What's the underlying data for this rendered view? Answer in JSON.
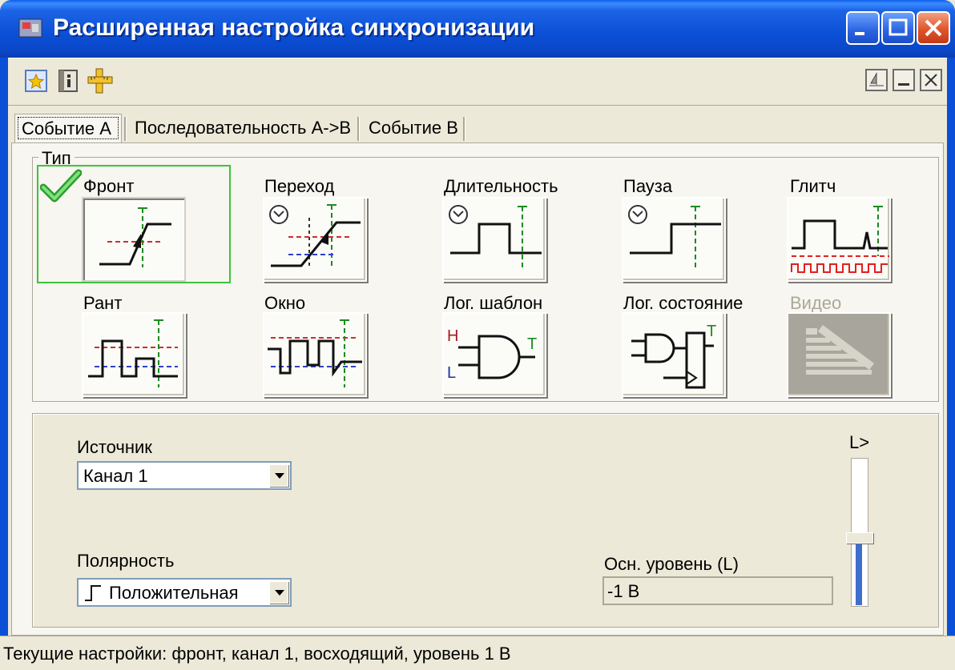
{
  "window": {
    "title": "Расширенная настройка синхронизации",
    "accent": "#0B4FD6"
  },
  "toolbar": {
    "icons": [
      "favorite-icon",
      "info-book-icon",
      "ruler-icon"
    ],
    "right_icons": [
      "sailboat-icon",
      "minimize-panel-icon",
      "close-panel-icon"
    ]
  },
  "tabs": [
    {
      "label": "Событие А",
      "active": true
    },
    {
      "label": "Последовательность А->В",
      "active": false
    },
    {
      "label": "Событие В",
      "active": false
    }
  ],
  "type_group": {
    "label": "Тип",
    "items": [
      {
        "label": "Фронт",
        "selected": true,
        "enabled": true
      },
      {
        "label": "Переход",
        "selected": false,
        "enabled": true
      },
      {
        "label": "Длительность",
        "selected": false,
        "enabled": true
      },
      {
        "label": "Пауза",
        "selected": false,
        "enabled": true
      },
      {
        "label": "Глитч",
        "selected": false,
        "enabled": true
      },
      {
        "label": "Рант",
        "selected": false,
        "enabled": true
      },
      {
        "label": "Окно",
        "selected": false,
        "enabled": true
      },
      {
        "label": "Лог. шаблон",
        "selected": false,
        "enabled": true
      },
      {
        "label": "Лог. состояние",
        "selected": false,
        "enabled": true
      },
      {
        "label": "Видео",
        "selected": false,
        "enabled": false
      }
    ]
  },
  "settings": {
    "source_label": "Источник",
    "source_value": "Канал 1",
    "polarity_label": "Полярность",
    "polarity_value": "Положительная",
    "level_label": "Осн. уровень (L)",
    "level_value": "-1 В",
    "slider_label": "L>",
    "slider_level": 0.46
  },
  "status": {
    "text": "Текущие настройки: фронт, канал 1, восходящий, уровень 1 В"
  }
}
